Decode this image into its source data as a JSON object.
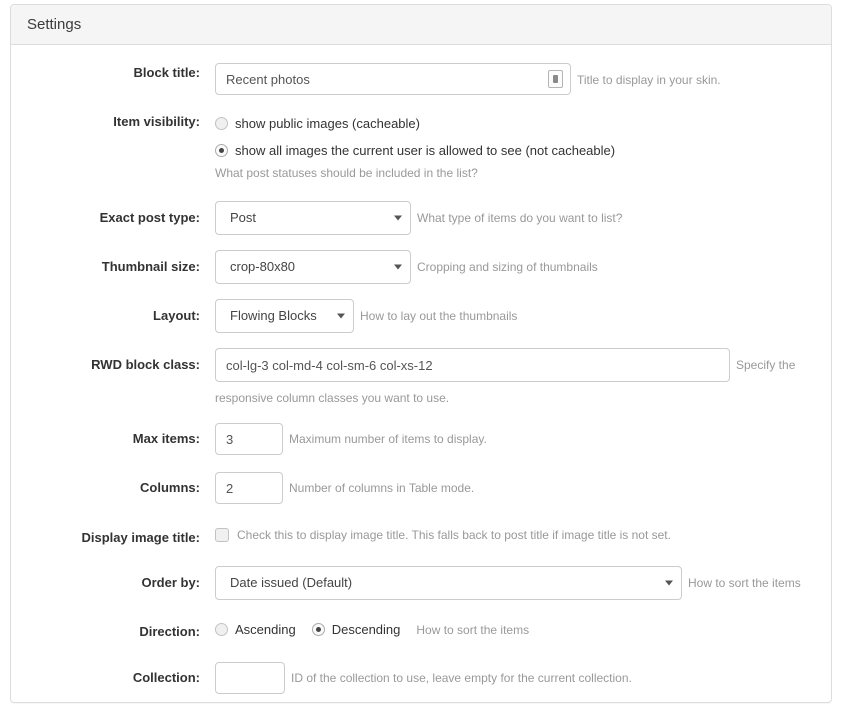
{
  "panel": {
    "title": "Settings"
  },
  "fields": {
    "block_title": {
      "label": "Block title:",
      "value": "Recent photos",
      "placeholder": "",
      "help": "Title to display in your skin.",
      "icon": "multilingual-icon"
    },
    "item_visibility": {
      "label": "Item visibility:",
      "options": [
        {
          "text": "show public images (cacheable)",
          "selected": false
        },
        {
          "text": "show all images the current user is allowed to see (not cacheable)",
          "selected": true
        }
      ],
      "help": "What post statuses should be included in the list?"
    },
    "exact_post_type": {
      "label": "Exact post type:",
      "value": "Post",
      "help": "What type of items do you want to list?"
    },
    "thumbnail_size": {
      "label": "Thumbnail size:",
      "value": "crop-80x80",
      "help": "Cropping and sizing of thumbnails"
    },
    "layout": {
      "label": "Layout:",
      "value": "Flowing Blocks",
      "help": "How to lay out the thumbnails"
    },
    "rwd_block_class": {
      "label": "RWD block class:",
      "value": "col-lg-3 col-md-4 col-sm-6 col-xs-12",
      "help_part1": "Specify the",
      "help_part2": "responsive column classes you want to use."
    },
    "max_items": {
      "label": "Max items:",
      "value": "3",
      "help": "Maximum number of items to display."
    },
    "columns": {
      "label": "Columns:",
      "value": "2",
      "help": "Number of columns in Table mode."
    },
    "display_image_title": {
      "label": "Display image title:",
      "checked": false,
      "help": "Check this to display image title. This falls back to post title if image title is not set."
    },
    "order_by": {
      "label": "Order by:",
      "value": "Date issued (Default)",
      "help": "How to sort the items"
    },
    "direction": {
      "label": "Direction:",
      "options": [
        {
          "text": "Ascending",
          "selected": false
        },
        {
          "text": "Descending",
          "selected": true
        }
      ],
      "help": "How to sort the items"
    },
    "collection": {
      "label": "Collection:",
      "value": "",
      "placeholder": "",
      "help": "ID of the collection to use, leave empty for the current collection."
    }
  },
  "colors": {
    "panel_border": "#dddddd",
    "heading_bg": "#f5f5f5",
    "text": "#333333",
    "help_text": "#999999",
    "input_border": "#cccccc"
  }
}
